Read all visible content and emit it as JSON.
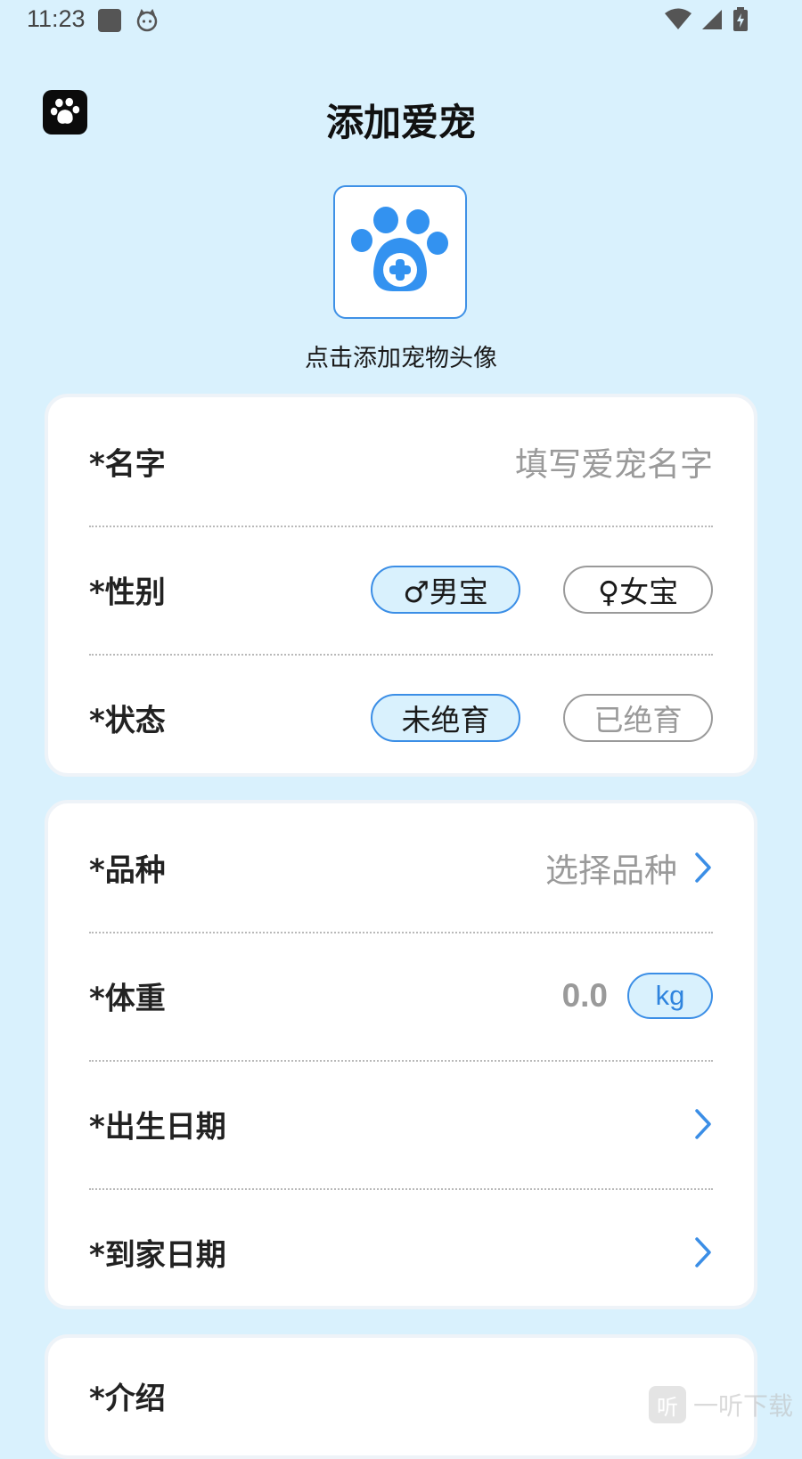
{
  "status_bar": {
    "time": "11:23"
  },
  "header": {
    "title": "添加爱宠"
  },
  "avatar": {
    "caption": "点击添加宠物头像"
  },
  "basic_card": {
    "name": {
      "label": "*名字",
      "placeholder": "填写爱宠名字"
    },
    "gender": {
      "label": "*性别",
      "options": [
        "♂男宝",
        "♀女宝"
      ],
      "selected": "♂男宝"
    },
    "status": {
      "label": "*状态",
      "options": [
        "未绝育",
        "已绝育"
      ],
      "selected": "未绝育"
    }
  },
  "detail_card": {
    "breed": {
      "label": "*品种",
      "placeholder": "选择品种"
    },
    "weight": {
      "label": "*体重",
      "value": "0.0",
      "unit": "kg"
    },
    "birth_date": {
      "label": "*出生日期"
    },
    "home_date": {
      "label": "*到家日期"
    }
  },
  "intro_card": {
    "label": "*介绍"
  },
  "watermark": {
    "icon_text": "听",
    "text": "一听下载"
  },
  "colors": {
    "background": "#d9f1fd",
    "accent": "#3b8ee6",
    "paw": "#3392f0"
  }
}
